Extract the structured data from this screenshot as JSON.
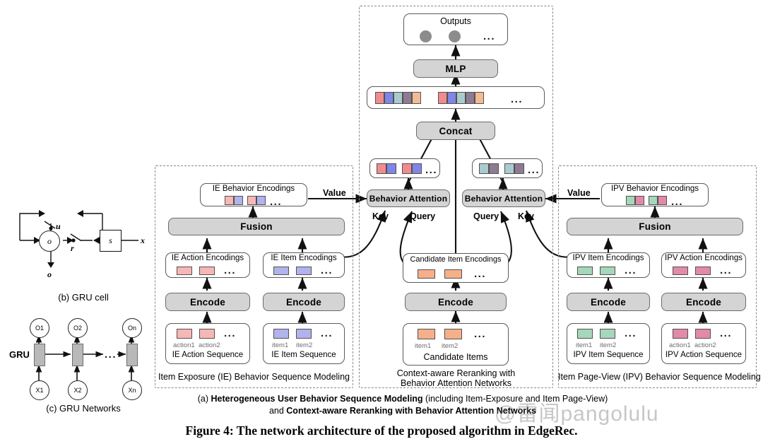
{
  "figure": {
    "caption_line1_prefix": "(a) ",
    "caption_line1_bold": "Heterogeneous User Behavior Sequence Modeling",
    "caption_line1_suffix": " (including Item-Exposure and Item Page-View)",
    "caption_line2_prefix": "and ",
    "caption_line2_bold": "Context-aware Reranking with Behavior Attention Networks",
    "figure_caption": "Figure 4: The network architecture of the proposed algorithm in EdgeRec.",
    "watermark": "@雷闻pangolulu"
  },
  "colors": {
    "ie_action": "#f6b7b7",
    "ie_item": "#b0b3ec",
    "ipv_item": "#a5d7bb",
    "ipv_action": "#e28aa9",
    "candidate": "#f5b08a",
    "teal": "#a9cbcf",
    "plum": "#8d7b94",
    "gray_node": "#8c8c8c",
    "box_fill": "#d4d4d4",
    "dash_border": "#888888"
  },
  "center_panel": {
    "caption_line1": "Context-aware Reranking with",
    "caption_line2": "Behavior Attention Networks",
    "outputs": {
      "label": "Outputs",
      "dots": "...",
      "nodes": 2
    },
    "mlp": {
      "label": "MLP"
    },
    "concat_vectors": {
      "groups": 2,
      "cells_per_group": 5,
      "cell_colors": [
        "#ef8d8d",
        "#7e86e8",
        "#a9cbcf",
        "#8d7b94",
        "#f3bb94"
      ],
      "dots": "..."
    },
    "concat": {
      "label": "Concat"
    },
    "attention_out_left": {
      "groups": 2,
      "cell_colors": [
        "#ef8d8d",
        "#7e86e8"
      ],
      "dots": "..."
    },
    "attention_out_right": {
      "groups": 2,
      "cell_colors": [
        "#a9cbcf",
        "#8d7b94"
      ],
      "dots": "..."
    },
    "behavior_attention_left": {
      "label": "Behavior Attention"
    },
    "behavior_attention_right": {
      "label": "Behavior Attention"
    },
    "arrow_labels": {
      "value_left": "Value",
      "key_left": "Key",
      "query_left": "Query",
      "query_right": "Query",
      "key_right": "Key",
      "value_right": "Value"
    },
    "candidate_item_encodings": {
      "title": "Candidate Item Encodings",
      "cells": 2,
      "color": "#f5b08a",
      "dots": "..."
    },
    "encode": {
      "label": "Encode"
    },
    "candidate_items": {
      "title": "Candidate Items",
      "cells": 2,
      "color": "#f5b08a",
      "item_labels": [
        "item1",
        "item2"
      ],
      "dots": "..."
    }
  },
  "left_panel": {
    "caption": "Item Exposure (IE) Behavior Sequence Modeling",
    "behavior_encodings": {
      "title": "IE Behavior Encodings",
      "groups": 2,
      "cell_colors": [
        "#f6b7b7",
        "#b0b3ec"
      ],
      "dots": "..."
    },
    "fusion": {
      "label": "Fusion"
    },
    "action_encodings": {
      "title": "IE Action Encodings",
      "cells": 2,
      "color": "#f6b7b7",
      "dots": "..."
    },
    "item_encodings": {
      "title": "IE Item Encodings",
      "cells": 2,
      "color": "#b0b3ec",
      "dots": "..."
    },
    "encode_left": {
      "label": "Encode"
    },
    "encode_right": {
      "label": "Encode"
    },
    "action_sequence": {
      "title": "IE Action Sequence",
      "cells": 2,
      "color": "#f6b7b7",
      "item_labels": [
        "action1",
        "action2"
      ],
      "dots": "..."
    },
    "item_sequence": {
      "title": "IE Item Sequence",
      "cells": 2,
      "color": "#b0b3ec",
      "item_labels": [
        "item1",
        "item2"
      ],
      "dots": "..."
    }
  },
  "right_panel": {
    "caption": "Item Page-View (IPV) Behavior Sequence Modeling",
    "behavior_encodings": {
      "title": "IPV Behavior Encodings",
      "groups": 2,
      "cell_colors": [
        "#a5d7bb",
        "#e28aa9"
      ],
      "dots": "..."
    },
    "fusion": {
      "label": "Fusion"
    },
    "item_encodings": {
      "title": "IPV Item Encodings",
      "cells": 2,
      "color": "#a5d7bb",
      "dots": "..."
    },
    "action_encodings": {
      "title": "IPV Action Encodings",
      "cells": 2,
      "color": "#e28aa9",
      "dots": "..."
    },
    "encode_left": {
      "label": "Encode"
    },
    "encode_right": {
      "label": "Encode"
    },
    "item_sequence": {
      "title": "IPV Item Sequence",
      "cells": 2,
      "color": "#a5d7bb",
      "item_labels": [
        "item1",
        "item2"
      ],
      "dots": "..."
    },
    "action_sequence": {
      "title": "IPV Action Sequence",
      "cells": 2,
      "color": "#e28aa9",
      "item_labels": [
        "action1",
        "action2"
      ],
      "dots": "..."
    }
  },
  "gru_cell": {
    "caption": "(b) GRU cell",
    "labels": {
      "u": "u",
      "o_node": "o",
      "o_out": "o",
      "r": "r",
      "s": "s",
      "x": "x"
    }
  },
  "gru_networks": {
    "caption": "(c) GRU Networks",
    "gru_label": "GRU",
    "outputs": [
      "O1",
      "O2",
      "On"
    ],
    "inputs": [
      "X1",
      "X2",
      "Xn"
    ],
    "dots": "..."
  }
}
